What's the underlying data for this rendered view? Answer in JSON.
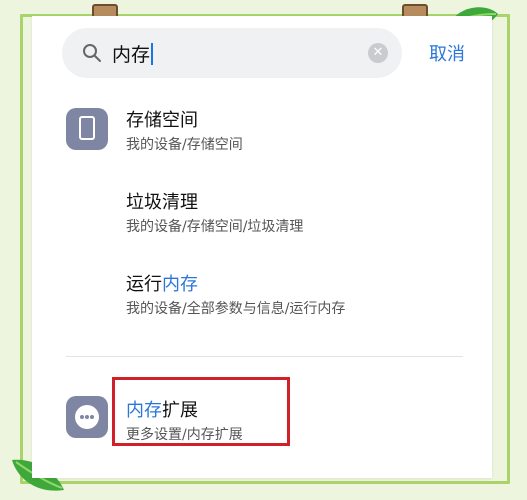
{
  "search": {
    "query": "内存",
    "clear_icon": "clear-icon",
    "search_icon": "search-icon",
    "cancel_label": "取消"
  },
  "results": [
    {
      "title": "存储空间",
      "title_highlight": "",
      "title_rest": "",
      "path": "我的设备/存储空间",
      "icon": "phone-storage-icon"
    },
    {
      "title": "垃圾清理",
      "title_highlight": "",
      "title_rest": "",
      "path": "我的设备/存储空间/垃圾清理",
      "icon": ""
    },
    {
      "title": "运行",
      "title_highlight": "内存",
      "title_rest": "",
      "path": "我的设备/全部参数与信息/运行内存",
      "icon": ""
    },
    {
      "title": "",
      "title_highlight": "内存",
      "title_rest": "扩展",
      "path": "更多设置/内存扩展",
      "icon": "more-dots-icon"
    }
  ],
  "colors": {
    "accent": "#2a77d8",
    "highlight_box": "#d0202a",
    "icon_bg": "#7f86a4"
  }
}
